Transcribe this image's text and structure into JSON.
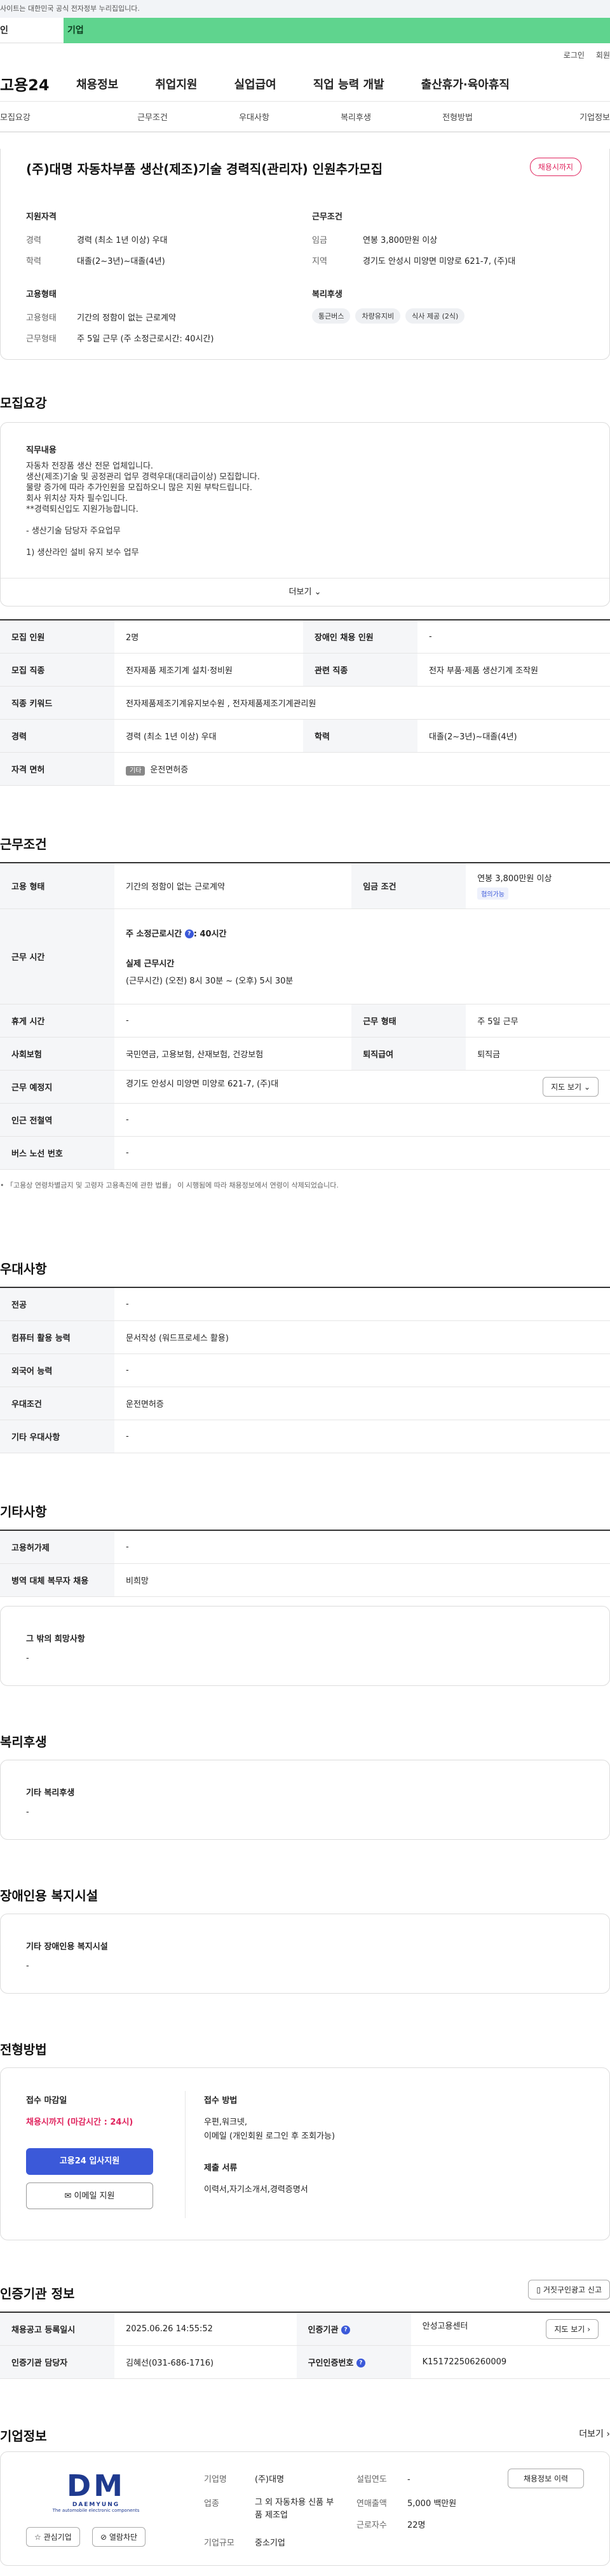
{
  "topbar": {
    "notice": "사이트는 대한민국 공식 전자정부 누리집입니다."
  },
  "tabs": {
    "individual": "인",
    "corporate": "기업"
  },
  "util": {
    "login": "로그인",
    "signup": "회원"
  },
  "gnb": {
    "logo": "고용24",
    "menu": [
      "채용정보",
      "취업지원",
      "실업급여",
      "직업 능력 개발",
      "출산휴가·육아휴직"
    ]
  },
  "subnav": [
    "모집요강",
    "근무조건",
    "우대사항",
    "복리후생",
    "전형방법",
    "기업정보"
  ],
  "summary": {
    "title": "(주)대명 자동차부품 생산(제조)기술 경력직(관리자) 인원추가모집",
    "badge": "채용시까지",
    "qualification": {
      "heading": "지원자격",
      "career_label": "경력",
      "career": "경력 (최소 1년 이상) 우대",
      "edu_label": "학력",
      "edu": "대졸(2~3년)~대졸(4년)"
    },
    "employment": {
      "heading": "고용형태",
      "type_label": "고용형태",
      "type": "기간의 정함이 없는 근로계약",
      "work_label": "근무형태",
      "work": "주 5일 근무 (주 소정근로시간: 40시간)"
    },
    "conditions": {
      "heading": "근무조건",
      "wage_label": "임금",
      "wage": "연봉 3,800만원 이상",
      "region_label": "지역",
      "region": "경기도 안성시 미양면 미양로 621-7, (주)대"
    },
    "welfare": {
      "heading": "복리후생",
      "chips": [
        "통근버스",
        "차량유지비",
        "식사 제공 (2식)"
      ]
    }
  },
  "recruit": {
    "heading": "모집요강",
    "job_desc_label": "직무내용",
    "job_desc": [
      "자동차 전장품 생산 전문 업체입니다.",
      "생산(제조)기술 및 공정관리 업무 경력우대(대리급이상) 모집합니다.",
      "물량 증가에 따라 추가인원을 모집하오니 많은 지원 부탁드립니다.",
      "회사 위치상 자차 필수입니다.",
      "**경력퇴신입도 지원가능합니다.",
      "",
      "- 생산기술 담당자 주요업무",
      "",
      "1) 생산라인 설비 유지 보수 업무"
    ],
    "more": "더보기",
    "rows": [
      {
        "k1": "모집 인원",
        "v1": "2명",
        "k2": "장애인 채용 인원",
        "v2": "-"
      },
      {
        "k1": "모집 직종",
        "v1": "전자제품 제조기계 설치·정비원",
        "k2": "관련 직종",
        "v2": "전자 부품·제품 생산기계 조작원"
      },
      {
        "k1": "직종 키워드",
        "v1": "전자제품제조기계유지보수원 , 전자제품제조기계관리원"
      },
      {
        "k1": "경력",
        "v1": "경력 (최소 1년 이상) 우대",
        "k2": "학력",
        "v2": "대졸(2~3년)~대졸(4년)"
      },
      {
        "k1": "자격 면허",
        "tag": "기타",
        "v1": "운전면허증"
      }
    ]
  },
  "work": {
    "heading": "근무조건",
    "emp_type_label": "고용 형태",
    "emp_type": "기간의 정함이 없는 근로계약",
    "wage_label": "임금 조건",
    "wage": "연봉 3,800만원 이상",
    "wage_tag": "협의가능",
    "time_label": "근무 시간",
    "time_main": "주 소정근로시간",
    "time_hours": ": 40시간",
    "time_detail_label": "실제 근무시간",
    "time_detail": "(근무시간) (오전) 8시 30분 ~ (오후) 5시 30분",
    "rest_label": "휴게 시간",
    "rest": "-",
    "form_label": "근무 형태",
    "form": "주 5일 근무",
    "ins_label": "사회보험",
    "ins": "국민연금, 고용보험, 산재보험, 건강보험",
    "ret_label": "퇴직급여",
    "ret": "퇴직금",
    "place_label": "근무 예정지",
    "place": "경기도 안성시 미양면 미양로 621-7, (주)대",
    "map_btn": "지도 보기",
    "subway_label": "인근 전철역",
    "subway": "-",
    "bus_label": "버스 노선 번호",
    "bus": "-",
    "notice": "「고용상 연령차별금지 및 고령자 고용촉진에 관한 법률」 이 시행됨에 따라 채용정보에서 연령이 삭제되었습니다."
  },
  "pref": {
    "heading": "우대사항",
    "rows": [
      {
        "k": "전공",
        "v": "-"
      },
      {
        "k": "컴퓨터 활용 능력",
        "v": "문서작성 (워드프로세스 활용)"
      },
      {
        "k": "외국어 능력",
        "v": "-"
      },
      {
        "k": "우대조건",
        "v": "운전면허증"
      },
      {
        "k": "기타 우대사항",
        "v": "-"
      }
    ]
  },
  "etc": {
    "heading": "기타사항",
    "rows": [
      {
        "k": "고용허가제",
        "v": "-"
      },
      {
        "k": "병역 대체 복무자 채용",
        "v": "비희망"
      }
    ],
    "hope_label": "그 밖의 희망사항",
    "hope": "-"
  },
  "welfare": {
    "heading": "복리후생",
    "label": "기타 복리후생",
    "value": "-"
  },
  "disabled": {
    "heading": "장애인용 복지시설",
    "label": "기타 장애인용 복지시설",
    "value": "-"
  },
  "apply": {
    "heading": "전형방법",
    "deadline_label": "접수 마감일",
    "deadline": "채용시까지 (마감시간 : 24시)",
    "apply_btn": "고용24 입사지원",
    "email_btn": "이메일 지원",
    "method_label": "접수 방법",
    "method": "우편,워크넷,",
    "method2": "이메일 (개인회원 로그인 후 조회가능)",
    "docs_label": "제출 서류",
    "docs": "이력서,자기소개서,경력증명서"
  },
  "agency": {
    "heading": "인증기관 정보",
    "report_btn": "거짓구인광고 신고",
    "reg_label": "채용공고 등록일시",
    "reg": "2025.06.26 14:55:52",
    "org_label": "인증기관",
    "org": "안성고용센터",
    "map_btn": "지도 보기",
    "manager_label": "인증기관 담당자",
    "manager": "김혜선(031-686-1716)",
    "id_label": "구인인증번호",
    "id": "K151722506260009"
  },
  "company": {
    "heading": "기업정보",
    "more": "더보기",
    "logo_text": "DM",
    "logo_sub": "DAEMYUNG",
    "logo_tag": "The automobile electronic components",
    "fav_btn": "관심기업",
    "block_btn": "열람차단",
    "name_label": "기업명",
    "name": "(주)대명",
    "industry_label": "업종",
    "industry": "그 외 자동차용 신품 부품 제조업",
    "size_label": "기업규모",
    "size": "중소기업",
    "founded_label": "설립연도",
    "founded": "-",
    "sales_label": "연매출액",
    "sales": "5,000 백만원",
    "staff_label": "근로자수",
    "staff": "22명",
    "jobs_btn": "채용정보 이력"
  }
}
